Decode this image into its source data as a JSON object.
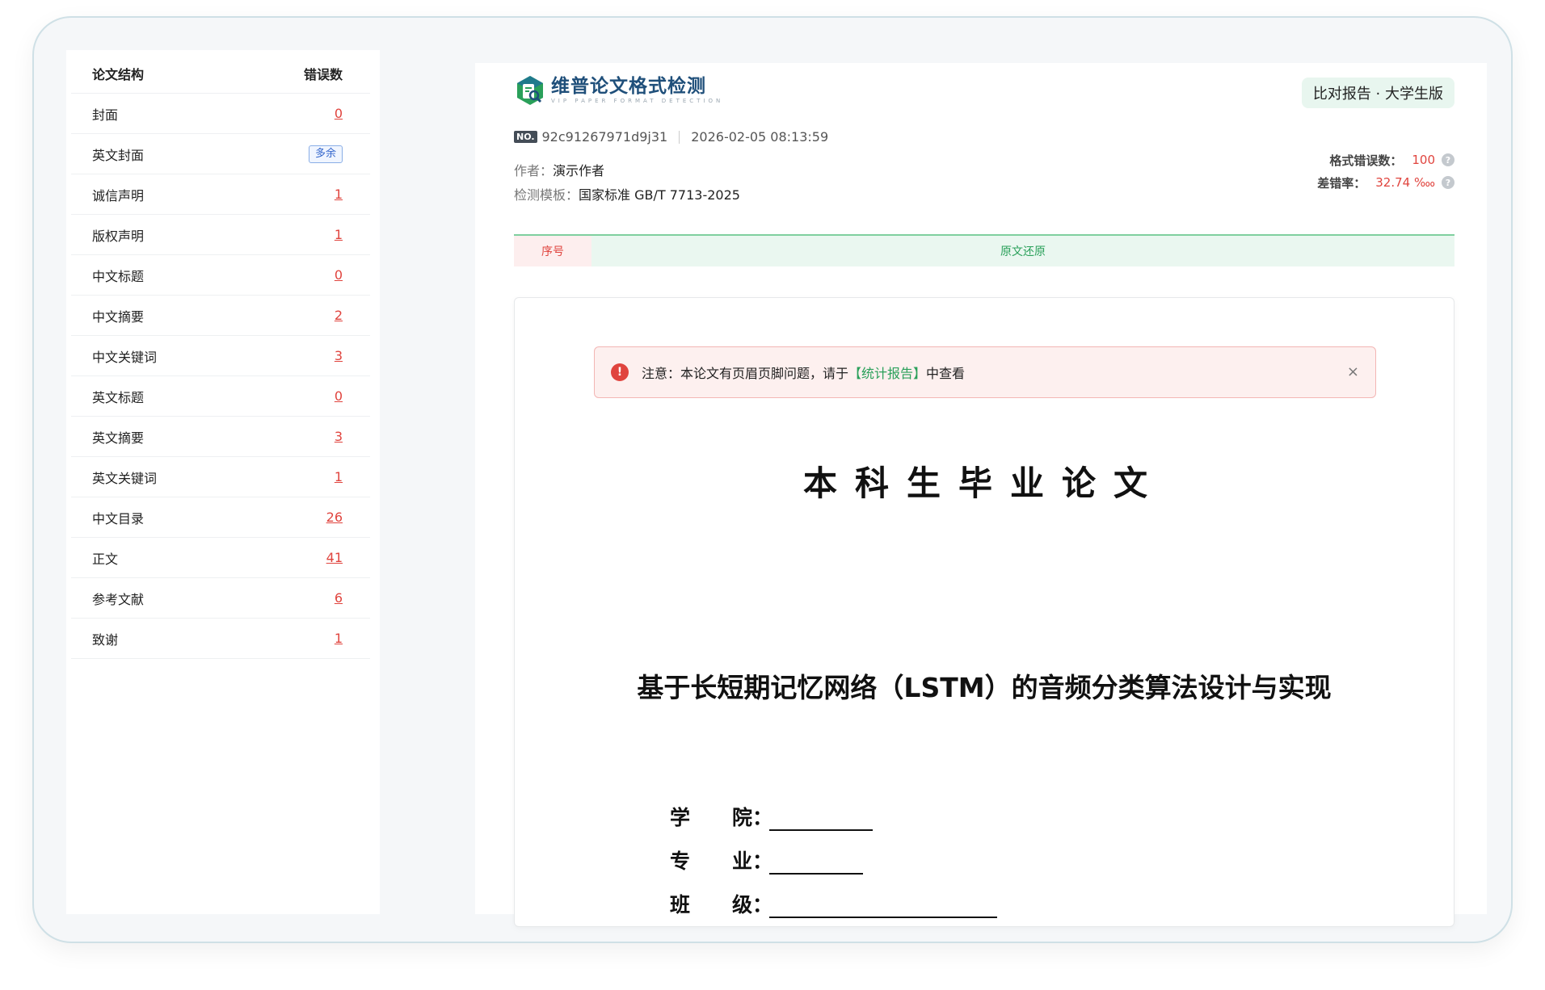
{
  "sidebar": {
    "header": {
      "structure": "论文结构",
      "errors": "错误数"
    },
    "items": [
      {
        "label": "封面",
        "count": "0"
      },
      {
        "label": "英文封面",
        "badge": "多余"
      },
      {
        "label": "诚信声明",
        "count": "1"
      },
      {
        "label": "版权声明",
        "count": "1"
      },
      {
        "label": "中文标题",
        "count": "0"
      },
      {
        "label": "中文摘要",
        "count": "2"
      },
      {
        "label": "中文关键词",
        "count": "3"
      },
      {
        "label": "英文标题",
        "count": "0"
      },
      {
        "label": "英文摘要",
        "count": "3"
      },
      {
        "label": "英文关键词",
        "count": "1"
      },
      {
        "label": "中文目录",
        "count": "26"
      },
      {
        "label": "正文",
        "count": "41"
      },
      {
        "label": "参考文献",
        "count": "6"
      },
      {
        "label": "致谢",
        "count": "1"
      }
    ]
  },
  "header": {
    "logo_title": "维普论文格式检测",
    "logo_sub": "VIP PAPER FORMAT DETECTION",
    "version": "比对报告 · 大学生版",
    "no_tag": "NO.",
    "report_no": "92c91267971d9j31",
    "timestamp": "2026-02-05 08:13:59",
    "author_key": "作者：",
    "author": "演示作者",
    "template_key": "检测模板：",
    "template": "国家标准 GB/T 7713-2025"
  },
  "stats": {
    "error_count_key": "格式错误数：",
    "error_count": "100",
    "error_rate_key": "差错率：",
    "error_rate": "32.74 ‱"
  },
  "tabs": {
    "seq": "序号",
    "original": "原文还原"
  },
  "alert": {
    "prefix": "注意：本论文有页眉页脚问题，请于",
    "link": "【统计报告】",
    "suffix": "中查看",
    "close": "×"
  },
  "document": {
    "title": "本科生毕业论文",
    "subtitle": "基于长短期记忆网络（LSTM）的音频分类算法设计与实现",
    "fields": [
      {
        "k1": "学",
        "k2": "院："
      },
      {
        "k1": "专",
        "k2": "业："
      },
      {
        "k1": "班",
        "k2": "级："
      }
    ]
  },
  "colors": {
    "accent_red": "#e0443e",
    "accent_green": "#2aa05a",
    "brand_blue": "#1f4f7a"
  },
  "icons": {
    "logo": "search-document-logo-icon",
    "alert": "exclamation-icon",
    "help": "question-icon",
    "close": "close-icon"
  }
}
